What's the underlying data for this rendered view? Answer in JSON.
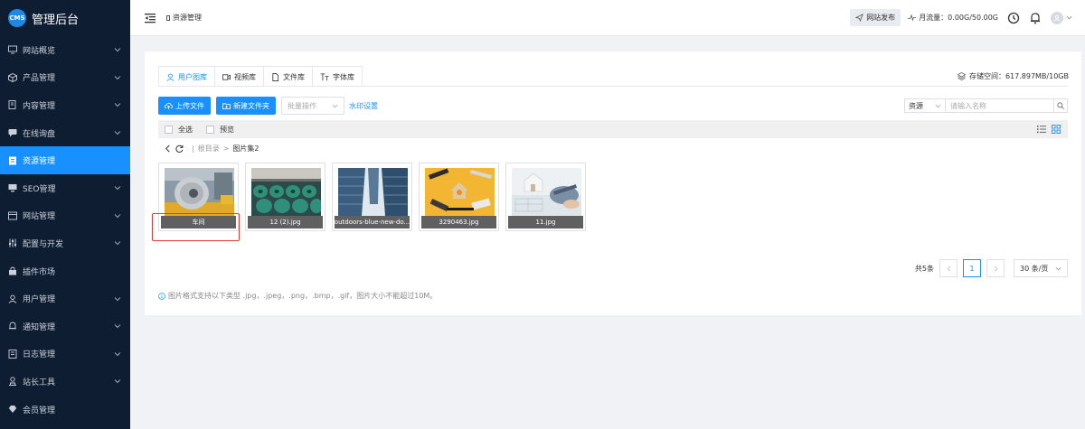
{
  "brand": {
    "logo": "CMS",
    "title": "管理后台"
  },
  "sidebar": {
    "items": [
      {
        "label": "网站概览",
        "icon": "dashboard-icon",
        "chevron": true
      },
      {
        "label": "产品管理",
        "icon": "cube-icon",
        "chevron": true
      },
      {
        "label": "内容管理",
        "icon": "document-icon",
        "chevron": true
      },
      {
        "label": "在线询盘",
        "icon": "chat-icon",
        "chevron": true
      },
      {
        "label": "资源管理",
        "icon": "folder-icon",
        "chevron": false,
        "active": true
      },
      {
        "label": "SEO管理",
        "icon": "monitor-icon",
        "chevron": true
      },
      {
        "label": "网站管理",
        "icon": "window-icon",
        "chevron": true
      },
      {
        "label": "配置与开发",
        "icon": "sliders-icon",
        "chevron": true
      },
      {
        "label": "插件市场",
        "icon": "plugin-icon",
        "chevron": false
      },
      {
        "label": "用户管理",
        "icon": "user-icon",
        "chevron": true
      },
      {
        "label": "通知管理",
        "icon": "bell-icon",
        "chevron": true
      },
      {
        "label": "日志管理",
        "icon": "log-icon",
        "chevron": true
      },
      {
        "label": "站长工具",
        "icon": "tool-icon",
        "chevron": true
      },
      {
        "label": "会员管理",
        "icon": "vip-icon",
        "chevron": false
      }
    ]
  },
  "header": {
    "breadcrumb": "资源管理",
    "publish": "网站发布",
    "traffic": "月流量：0.00G/50.00G"
  },
  "tabs": [
    {
      "label": "用户图库",
      "active": true
    },
    {
      "label": "视频库"
    },
    {
      "label": "文件库"
    },
    {
      "label": "字体库"
    }
  ],
  "storage": "存储空间：617.897MB/10GB",
  "toolbar": {
    "upload": "上传文件",
    "new_folder": "新建文件夹",
    "batch_placeholder": "批量操作",
    "watermark": "水印设置",
    "search_type": "资源",
    "search_placeholder": "请输入名称"
  },
  "selection": {
    "select_all": "全选",
    "preview": "预览"
  },
  "path": {
    "root": "根目录",
    "sep": ">",
    "current": "图片集2"
  },
  "files": [
    {
      "name": "车间",
      "type": "folder"
    },
    {
      "name": "12 (2).jpg"
    },
    {
      "name": "outdoors-blue-new-do..."
    },
    {
      "name": "3290463.jpg"
    },
    {
      "name": "11.jpg"
    }
  ],
  "pager": {
    "total": "共5条",
    "page": "1",
    "size": "30 条/页"
  },
  "note": "图片格式支持以下类型 .jpg，.jpeg，.png，.bmp，.gif，图片大小不能超过10M。",
  "colors": {
    "accent": "#1890ff",
    "sidebar": "#0f1d33",
    "highlight": "#e53935"
  }
}
